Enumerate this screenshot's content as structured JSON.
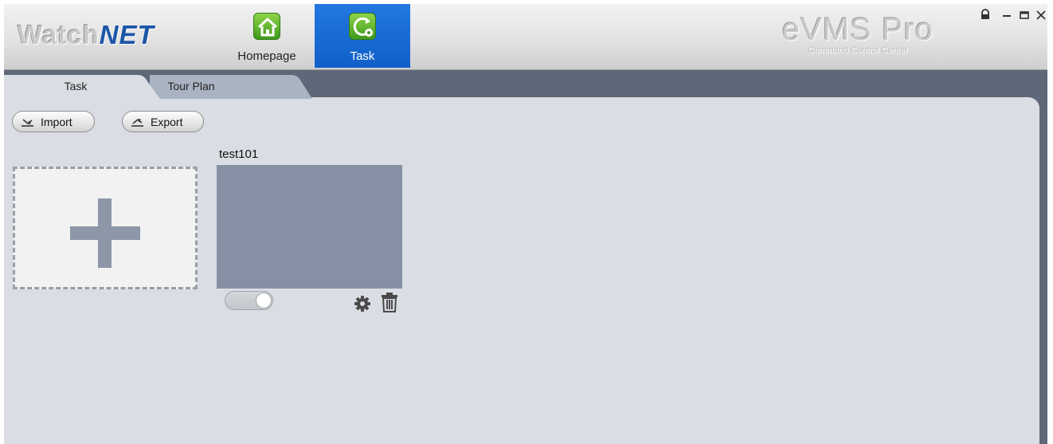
{
  "header": {
    "logo": {
      "part1": "Watch",
      "part2": "NET"
    },
    "nav": [
      {
        "label": "Homepage",
        "icon": "home-icon",
        "active": false
      },
      {
        "label": "Task",
        "icon": "task-refresh-gear-icon",
        "active": true
      }
    ],
    "brand": {
      "name": "eVMS Pro",
      "subtitle": "Command Control Center"
    },
    "window_controls": [
      "lock-icon",
      "minimize-icon",
      "maximize-icon",
      "close-icon"
    ]
  },
  "tabs": [
    {
      "label": "Task",
      "active": true
    },
    {
      "label": "Tour Plan",
      "active": false
    }
  ],
  "toolbar": {
    "import_label": "Import",
    "export_label": "Export"
  },
  "tasks": [
    {
      "name": "test101",
      "enabled": false
    }
  ],
  "colors": {
    "accent_blue": "#1565d0",
    "card_thumbnail": "#8590a5",
    "content_bg": "#dadde3",
    "app_dark_bg": "#5f6878"
  }
}
